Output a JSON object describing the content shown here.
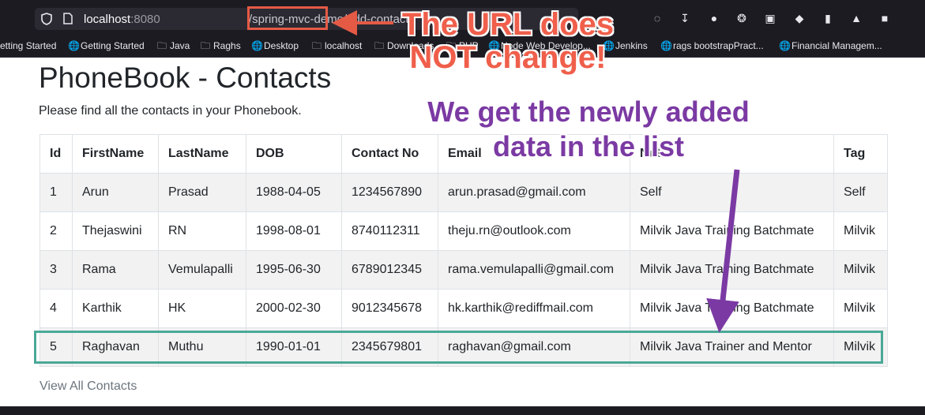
{
  "browser": {
    "url_host": "localhost",
    "url_port": ":8080",
    "url_path": "/spring-mvc-demo/add-contact",
    "bookmarks": [
      {
        "label": "etting Started",
        "icon": "firefox-icon"
      },
      {
        "label": "Getting Started",
        "icon": "globe-icon"
      },
      {
        "label": "Java",
        "icon": "folder-icon"
      },
      {
        "label": "Raghs",
        "icon": "folder-icon"
      },
      {
        "label": "Desktop",
        "icon": "globe-icon"
      },
      {
        "label": "localhost",
        "icon": "folder-icon"
      },
      {
        "label": "Downloads",
        "icon": "folder-icon"
      },
      {
        "label": "PHP",
        "icon": "folder-icon"
      },
      {
        "label": "Node Web Develop...",
        "icon": "globe-icon"
      },
      {
        "label": "Jenkins",
        "icon": "globe-icon"
      },
      {
        "label": "rags bootstrapPract...",
        "icon": "globe-icon"
      },
      {
        "label": "Financial Managem...",
        "icon": "globe-icon"
      }
    ]
  },
  "page": {
    "title": "PhoneBook - Contacts",
    "lead": "Please find all the contacts in your Phonebook.",
    "view_all": "View All Contacts"
  },
  "table": {
    "headers": [
      "Id",
      "FirstName",
      "LastName",
      "DOB",
      "Contact No",
      "Email",
      "Note",
      "Tag"
    ],
    "rows": [
      [
        "1",
        "Arun",
        "Prasad",
        "1988-04-05",
        "1234567890",
        "arun.prasad@gmail.com",
        "Self",
        "Self"
      ],
      [
        "2",
        "Thejaswini",
        "RN",
        "1998-08-01",
        "8740112311",
        "theju.rn@outlook.com",
        "Milvik Java Training Batchmate",
        "Milvik"
      ],
      [
        "3",
        "Rama",
        "Vemulapalli",
        "1995-06-30",
        "6789012345",
        "rama.vemulapalli@gmail.com",
        "Milvik Java Training Batchmate",
        "Milvik"
      ],
      [
        "4",
        "Karthik",
        "HK",
        "2000-02-30",
        "9012345678",
        "hk.karthik@rediffmail.com",
        "Milvik Java Training Batchmate",
        "Milvik"
      ],
      [
        "5",
        "Raghavan",
        "Muthu",
        "1990-01-01",
        "2345679801",
        "raghavan@gmail.com",
        "Milvik Java Trainer and Mentor",
        "Milvik"
      ]
    ]
  },
  "annotations": {
    "url_note_line1": "The URL does",
    "url_note_line2": "NOT change!",
    "list_note_line1": "We get the newly added",
    "list_note_line2": "data in the list",
    "red_color": "#ef5f4b",
    "purple_color": "#7b3aa3",
    "teal_color": "#4aa897"
  }
}
